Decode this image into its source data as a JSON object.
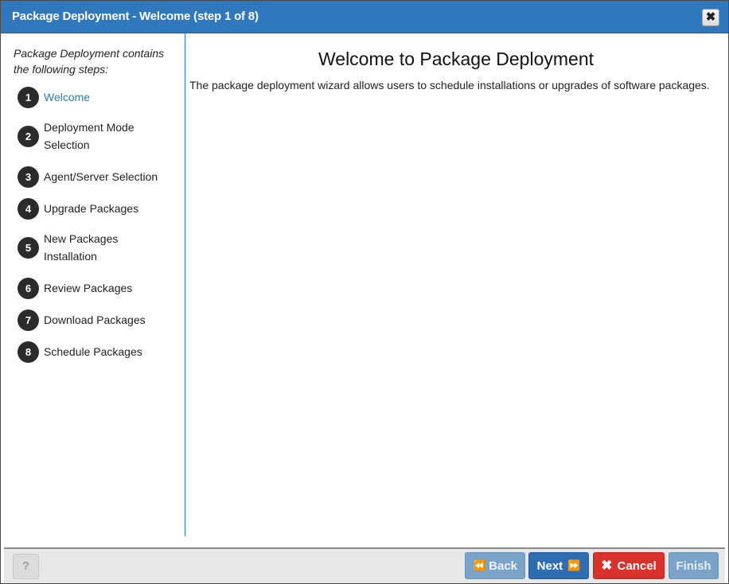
{
  "window": {
    "title": "Package Deployment - Welcome (step 1 of 8)",
    "close_icon": "✖"
  },
  "sidebar": {
    "intro": "Package Deployment contains the following steps:",
    "steps": [
      {
        "num": "1",
        "label": "Welcome",
        "active": true
      },
      {
        "num": "2",
        "label": "Deployment Mode Selection",
        "active": false
      },
      {
        "num": "3",
        "label": "Agent/Server Selection",
        "active": false
      },
      {
        "num": "4",
        "label": "Upgrade Packages",
        "active": false
      },
      {
        "num": "5",
        "label": "New Packages Installation",
        "active": false
      },
      {
        "num": "6",
        "label": "Review Packages",
        "active": false
      },
      {
        "num": "7",
        "label": "Download Packages",
        "active": false
      },
      {
        "num": "8",
        "label": "Schedule Packages",
        "active": false
      }
    ]
  },
  "main": {
    "heading": "Welcome to Package Deployment",
    "description": "The package deployment wizard allows users to schedule installations or upgrades of software packages."
  },
  "footer": {
    "help_label": "?",
    "back_label": "Back",
    "back_icon": "⏪",
    "next_label": "Next",
    "next_icon": "⏩",
    "cancel_label": "Cancel",
    "cancel_icon": "✖",
    "finish_label": "Finish"
  },
  "colors": {
    "titlebar": "#2f78bd",
    "active_step": "#2a7ab8",
    "next_button": "#2d6eb3",
    "cancel_button": "#d9312b",
    "disabled_button": "#7aa3c8"
  }
}
